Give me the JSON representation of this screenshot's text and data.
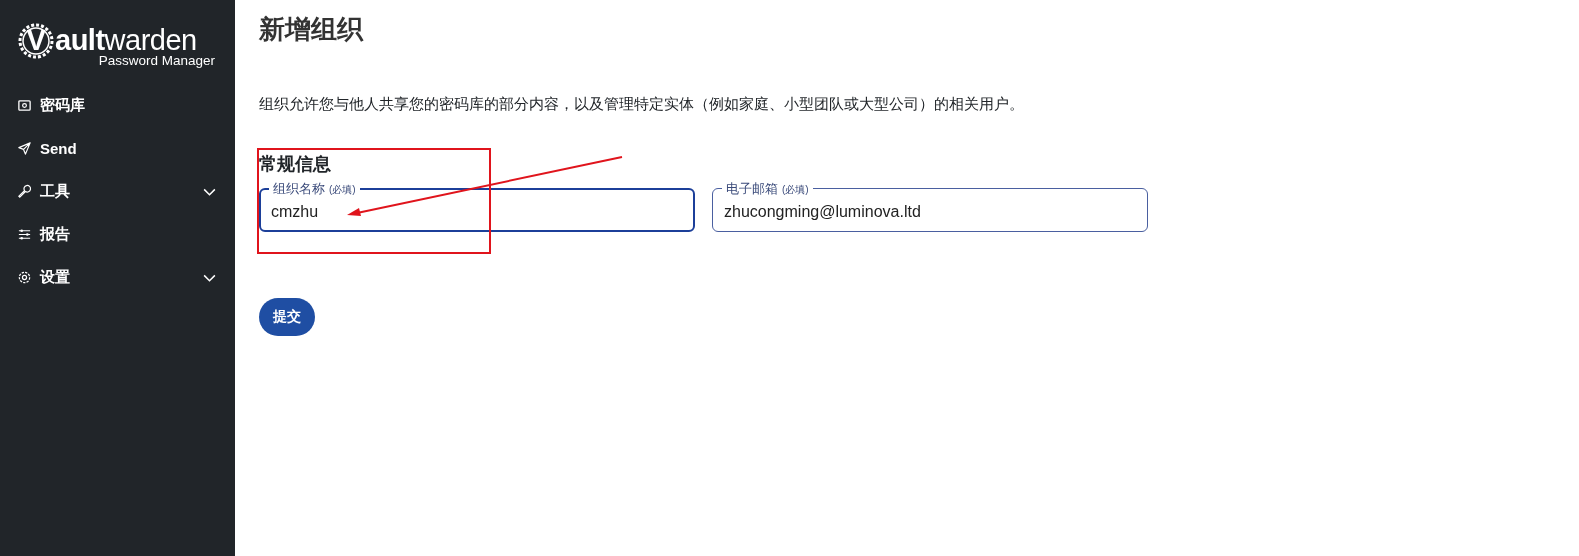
{
  "sidebar": {
    "logo": {
      "wordmark_mark": "V",
      "wordmark_bold": "ault",
      "wordmark_light": "warden",
      "tagline": "Password Manager"
    },
    "items": [
      {
        "label": "密码库",
        "kind": "link"
      },
      {
        "label": "Send",
        "kind": "link"
      },
      {
        "label": "工具",
        "kind": "group",
        "expanded": false
      },
      {
        "label": "报告",
        "kind": "link"
      },
      {
        "label": "设置",
        "kind": "group",
        "expanded": false
      }
    ]
  },
  "page": {
    "title": "新增组织",
    "description": "组织允许您与他人共享您的密码库的部分内容，以及管理特定实体（例如家庭、小型团队或大型公司）的相关用户。",
    "section_title": "常规信息",
    "fields": [
      {
        "label": "组织名称",
        "required_note": "(必填)",
        "value": "cmzhu",
        "focused": true
      },
      {
        "label": "电子邮箱",
        "required_note": "(必填)",
        "value": "zhucongming@luminova.ltd",
        "focused": false
      }
    ],
    "submit_button": "提交"
  },
  "annotations": [
    {
      "kind": "box"
    },
    {
      "kind": "arrow"
    }
  ]
}
